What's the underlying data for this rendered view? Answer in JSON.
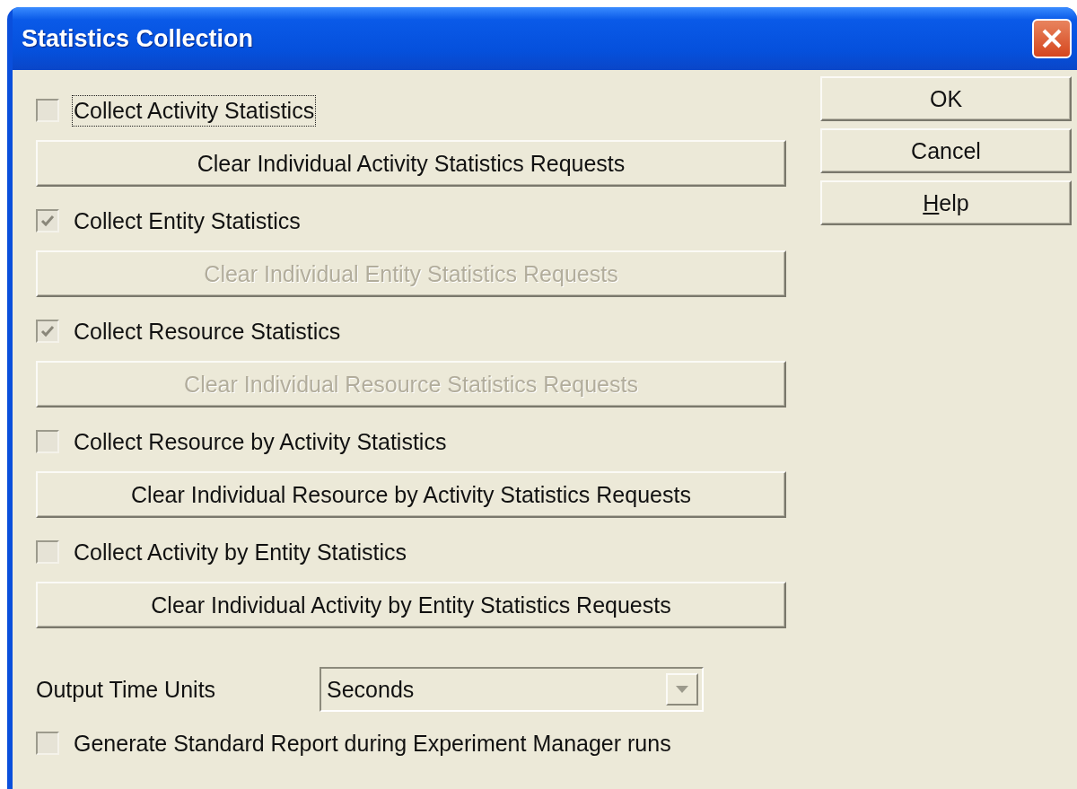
{
  "window": {
    "title": "Statistics Collection"
  },
  "options": [
    {
      "kind": "checkbox",
      "label": "Collect Activity Statistics",
      "checked": false,
      "focused": true
    },
    {
      "kind": "button",
      "label": "Clear Individual Activity Statistics Requests",
      "disabled": false
    },
    {
      "kind": "checkbox",
      "label": "Collect Entity Statistics",
      "checked": true,
      "focused": false
    },
    {
      "kind": "button",
      "label": "Clear Individual Entity Statistics Requests",
      "disabled": true
    },
    {
      "kind": "checkbox",
      "label": "Collect Resource Statistics",
      "checked": true,
      "focused": false
    },
    {
      "kind": "button",
      "label": "Clear Individual Resource Statistics Requests",
      "disabled": true
    },
    {
      "kind": "checkbox",
      "label": "Collect Resource by Activity Statistics",
      "checked": false,
      "focused": false
    },
    {
      "kind": "button",
      "label": "Clear Individual Resource by Activity Statistics Requests",
      "disabled": false
    },
    {
      "kind": "checkbox",
      "label": "Collect Activity by Entity Statistics",
      "checked": false,
      "focused": false
    },
    {
      "kind": "button",
      "label": "Clear Individual Activity by Entity Statistics Requests",
      "disabled": false
    }
  ],
  "output_time_units": {
    "label": "Output Time Units",
    "value": "Seconds",
    "disabled": true
  },
  "report_option": {
    "label": "Generate Standard Report during Experiment Manager runs",
    "checked": false
  },
  "buttons": [
    {
      "label": "OK",
      "underline_first": false
    },
    {
      "label": "Cancel",
      "underline_first": false
    },
    {
      "label": "Help",
      "underline_first": true
    }
  ]
}
